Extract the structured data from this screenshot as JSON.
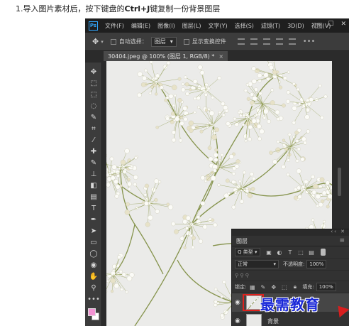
{
  "instruction": {
    "prefix": "1.导入图片素材后，按下键盘的",
    "shortcut": "Ctrl+J",
    "suffix": "键复制一份背景图层"
  },
  "app": {
    "logo": "Ps",
    "menu": [
      "文件(F)",
      "编辑(E)",
      "图像(I)",
      "图层(L)",
      "文字(Y)",
      "选择(S)",
      "滤镜(T)",
      "3D(D)",
      "视图(V)"
    ],
    "window_controls": [
      "—",
      "☐",
      "✕"
    ]
  },
  "options_bar": {
    "auto_select_label": "自动选择：",
    "auto_select_value": "图层",
    "transform_label": "显示变换控件",
    "more": "•••"
  },
  "document_tab": {
    "title": "30404.jpeg @ 100% (图层 1, RGB/8) *",
    "close": "×"
  },
  "tools": [
    {
      "name": "move-tool-icon",
      "glyph": "✥"
    },
    {
      "name": "artboard-tool-icon",
      "glyph": "⬚"
    },
    {
      "name": "marquee-tool-icon",
      "glyph": "⬚"
    },
    {
      "name": "lasso-tool-icon",
      "glyph": "◌"
    },
    {
      "name": "quick-select-tool-icon",
      "glyph": "✎"
    },
    {
      "name": "crop-tool-icon",
      "glyph": "⌗"
    },
    {
      "name": "eyedropper-tool-icon",
      "glyph": "⁄"
    },
    {
      "name": "healing-brush-tool-icon",
      "glyph": "✚"
    },
    {
      "name": "brush-tool-icon",
      "glyph": "✎"
    },
    {
      "name": "clone-stamp-tool-icon",
      "glyph": "⊥"
    },
    {
      "name": "eraser-tool-icon",
      "glyph": "◧"
    },
    {
      "name": "gradient-tool-icon",
      "glyph": "▤"
    },
    {
      "name": "type-tool-icon",
      "glyph": "T"
    },
    {
      "name": "pen-tool-icon",
      "glyph": "✒"
    },
    {
      "name": "path-select-tool-icon",
      "glyph": "➤"
    },
    {
      "name": "rectangle-tool-icon",
      "glyph": "▭"
    },
    {
      "name": "ellipse-tool-icon",
      "glyph": "◯"
    },
    {
      "name": "custom-shape-tool-icon",
      "glyph": "◉"
    },
    {
      "name": "hand-tool-icon",
      "glyph": "✋"
    },
    {
      "name": "zoom-tool-icon",
      "glyph": "⚲"
    }
  ],
  "tool_more": "•••",
  "colors": {
    "foreground": "#f293d3",
    "background": "#ffffff",
    "highlight": "#e0211c",
    "watermark": "#1a28d8"
  },
  "layers_panel": {
    "title": "图层",
    "filter_kind": "Q 类型",
    "blend_mode": "正常",
    "opacity_label": "不透明度:",
    "opacity_value": "100%",
    "lock_label": "锁定:",
    "fill_label": "填充:",
    "fill_value": "100%",
    "top_layer_name": "图层 1",
    "bottom_layer_name": "背景"
  },
  "watermark_text": "最需教育"
}
